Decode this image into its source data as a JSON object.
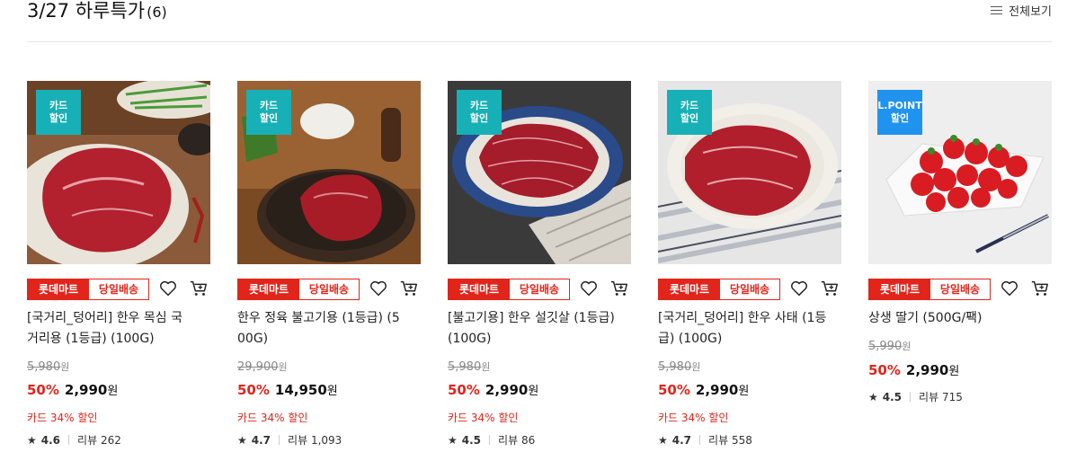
{
  "header": {
    "title": "3/27 하루특가",
    "count": "(6)",
    "view_all": "전체보기"
  },
  "tags": {
    "lotte": "롯데마트",
    "sameday": "당일배송"
  },
  "colors": {
    "brand_red": "#e1251b",
    "card_badge_teal": "#17b0b6",
    "lpoint_badge_blue": "#1f93ee"
  },
  "products": [
    {
      "badge": [
        "카드",
        "할인"
      ],
      "name_lines": [
        "[국거리_덩어리] 한우 목심 국",
        "거리용 (1등급) (100G)"
      ],
      "orig_price": "5,980",
      "orig_unit": "원",
      "discount": "50%",
      "price": "2,990",
      "price_unit": "원",
      "card_discount": "카드 34% 할인",
      "rating": "4.6",
      "review_label": "리뷰",
      "review_count": "262"
    },
    {
      "badge": [
        "카드",
        "할인"
      ],
      "name_lines": [
        "한우 정육 불고기용 (1등급) (5",
        "00G)"
      ],
      "orig_price": "29,900",
      "orig_unit": "원",
      "discount": "50%",
      "price": "14,950",
      "price_unit": "원",
      "card_discount": "카드 34% 할인",
      "rating": "4.7",
      "review_label": "리뷰",
      "review_count": "1,093"
    },
    {
      "badge": [
        "카드",
        "할인"
      ],
      "name_lines": [
        "[불고기용] 한우 설깃살 (1등급)",
        "(100G)"
      ],
      "orig_price": "5,980",
      "orig_unit": "원",
      "discount": "50%",
      "price": "2,990",
      "price_unit": "원",
      "card_discount": "카드 34% 할인",
      "rating": "4.5",
      "review_label": "리뷰",
      "review_count": "86"
    },
    {
      "badge": [
        "카드",
        "할인"
      ],
      "name_lines": [
        "[국거리_덩어리] 한우 사태 (1등",
        "급) (100G)"
      ],
      "orig_price": "5,980",
      "orig_unit": "원",
      "discount": "50%",
      "price": "2,990",
      "price_unit": "원",
      "card_discount": "카드 34% 할인",
      "rating": "4.7",
      "review_label": "리뷰",
      "review_count": "558"
    },
    {
      "badge": [
        "L.POINT",
        "할인"
      ],
      "name_lines": [
        "상생 딸기 (500G/팩)",
        ""
      ],
      "orig_price": "5,990",
      "orig_unit": "원",
      "discount": "50%",
      "price": "2,990",
      "price_unit": "원",
      "card_discount": "",
      "rating": "4.5",
      "review_label": "리뷰",
      "review_count": "715"
    }
  ]
}
